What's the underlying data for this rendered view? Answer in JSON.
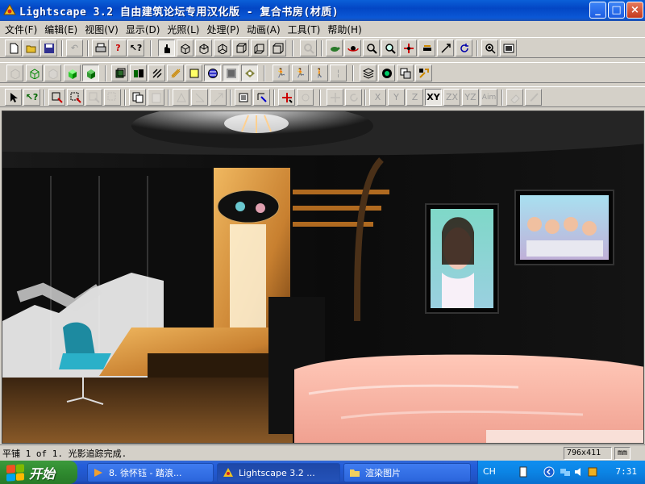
{
  "window": {
    "title": "Lightscape 3.2 自由建筑论坛专用汉化版  - 复合书房(材质)",
    "minimize_label": "_",
    "maximize_label": "□",
    "close_label": "×"
  },
  "menu": {
    "items": [
      {
        "id": "file",
        "label": "文件(F)"
      },
      {
        "id": "edit",
        "label": "编辑(E)"
      },
      {
        "id": "view",
        "label": "视图(V)"
      },
      {
        "id": "display",
        "label": "显示(D)"
      },
      {
        "id": "light",
        "label": "光照(L)"
      },
      {
        "id": "process",
        "label": "处理(P)"
      },
      {
        "id": "animation",
        "label": "动画(A)"
      },
      {
        "id": "tools",
        "label": "工具(T)"
      },
      {
        "id": "help",
        "label": "帮助(H)"
      }
    ]
  },
  "toolbar3": {
    "x_label": "X",
    "y_label": "Y",
    "z_label": "Z",
    "xy_label": "XY",
    "zx_label": "ZX",
    "yz_label": "YZ",
    "aim_label": "Aim"
  },
  "status": {
    "message": "平铺 1 of 1. 光影追踪完成.",
    "resolution": "796x411",
    "units": "mm"
  },
  "taskbar": {
    "start_label": "开始",
    "tasks": [
      {
        "label": "8. 徐怀钰 - 踏浪..."
      },
      {
        "label": "Lightscape 3.2 ..."
      },
      {
        "label": "渲染图片"
      }
    ],
    "lang": "CH",
    "clock": "7:31"
  },
  "colors": {
    "title_bar": "#0a5fd8",
    "chrome": "#d4d0c8",
    "taskbar": "#245edb",
    "start_button": "#2f8a2f",
    "tray": "#0b84e4"
  }
}
